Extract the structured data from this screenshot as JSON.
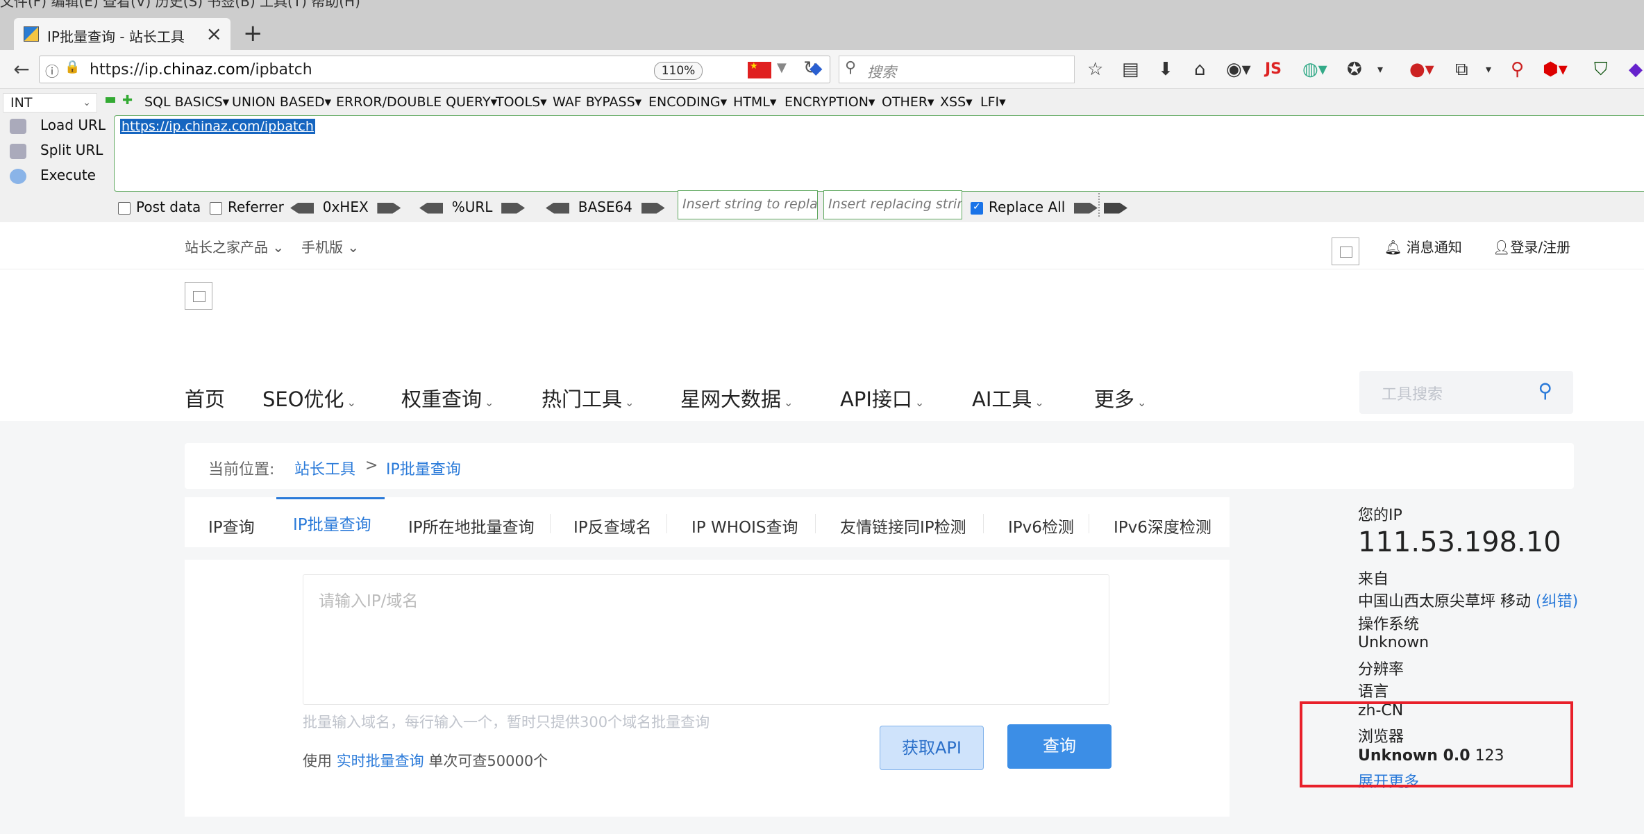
{
  "browser": {
    "top_menu": "文件(F)  编辑(E)  查看(V)  历史(S)  书签(B)  工具(T)  帮助(H)",
    "tab_title": "IP批量查询 - 站长工具",
    "url_prefix": "https://ip.",
    "url_domain": "chinaz.com",
    "url_path": "/ipbatch",
    "zoom": "110%",
    "search_placeholder": "搜索",
    "toolbar_icons": [
      "bookmark-star-icon",
      "reading-list-icon",
      "download-icon",
      "home-icon",
      "globe-icon",
      "js-icon",
      "addon-icon",
      "palette-icon",
      "lastpass-icon",
      "feed-icon",
      "magnifier-icon",
      "adblock-icon",
      "shield-icon",
      "extension-icon"
    ]
  },
  "hackbar": {
    "int_select": "INT",
    "menus": [
      "SQL BASICS▾",
      "UNION BASED▾",
      "ERROR/DOUBLE QUERY▾",
      "TOOLS▾",
      "WAF BYPASS▾",
      "ENCODING▾",
      "HTML▾",
      "ENCRYPTION▾",
      "OTHER▾",
      "XSS▾",
      "LFI▾"
    ],
    "load_url": "Load URL",
    "split_url": "Split URL",
    "execute": "Execute",
    "url_value": "https://ip.chinaz.com/ipbatch",
    "post_data": "Post data",
    "referrer": "Referrer",
    "hex": "0xHEX",
    "pct_url": "%URL",
    "base64": "BASE64",
    "replace_placeholder": "Insert string to replace",
    "replacing_placeholder": "Insert replacing string",
    "replace_all": "Replace All"
  },
  "site": {
    "top_links": [
      "站长之家产品",
      "手机版"
    ],
    "notify": "消息通知",
    "login": "登录/注册",
    "nav": [
      "首页",
      "SEO优化",
      "权重查询",
      "热门工具",
      "星网大数据",
      "API接口",
      "AI工具",
      "更多"
    ],
    "tool_search_placeholder": "工具搜索",
    "breadcrumb_label": "当前位置:",
    "breadcrumb_home": "站长工具",
    "breadcrumb_sep": ">",
    "breadcrumb_current": "IP批量查询",
    "tabs": [
      "IP查询",
      "IP批量查询",
      "IP所在地批量查询",
      "IP反查域名",
      "IP WHOIS查询",
      "友情链接同IP检测",
      "IPv6检测",
      "IPv6深度检测"
    ],
    "textarea_placeholder": "请输入IP/域名",
    "hint": "批量输入域名，每行输入一个，暂时只提供300个域名批量查询",
    "use_prefix": "使用",
    "use_link": "实时批量查询",
    "use_suffix": "单次可查50000个",
    "api_button": "获取API",
    "query_button": "查询"
  },
  "ipinfo": {
    "your_ip_label": "您的IP",
    "ip": "111.53.198.10",
    "from_label": "来自",
    "location": "中国山西太原尖草坪 移动",
    "correct_link": "(纠错)",
    "os_label": "操作系统",
    "os": "Unknown",
    "resolution_label": "分辨率",
    "language_label": "语言",
    "language": "zh-CN",
    "browser_label": "浏览器",
    "browser_bold": "Unknown 0.0",
    "browser_extra": "123",
    "expand": "展开更多"
  },
  "colors": {
    "accent": "#2a7ad9",
    "highlight": "#e8202a"
  }
}
